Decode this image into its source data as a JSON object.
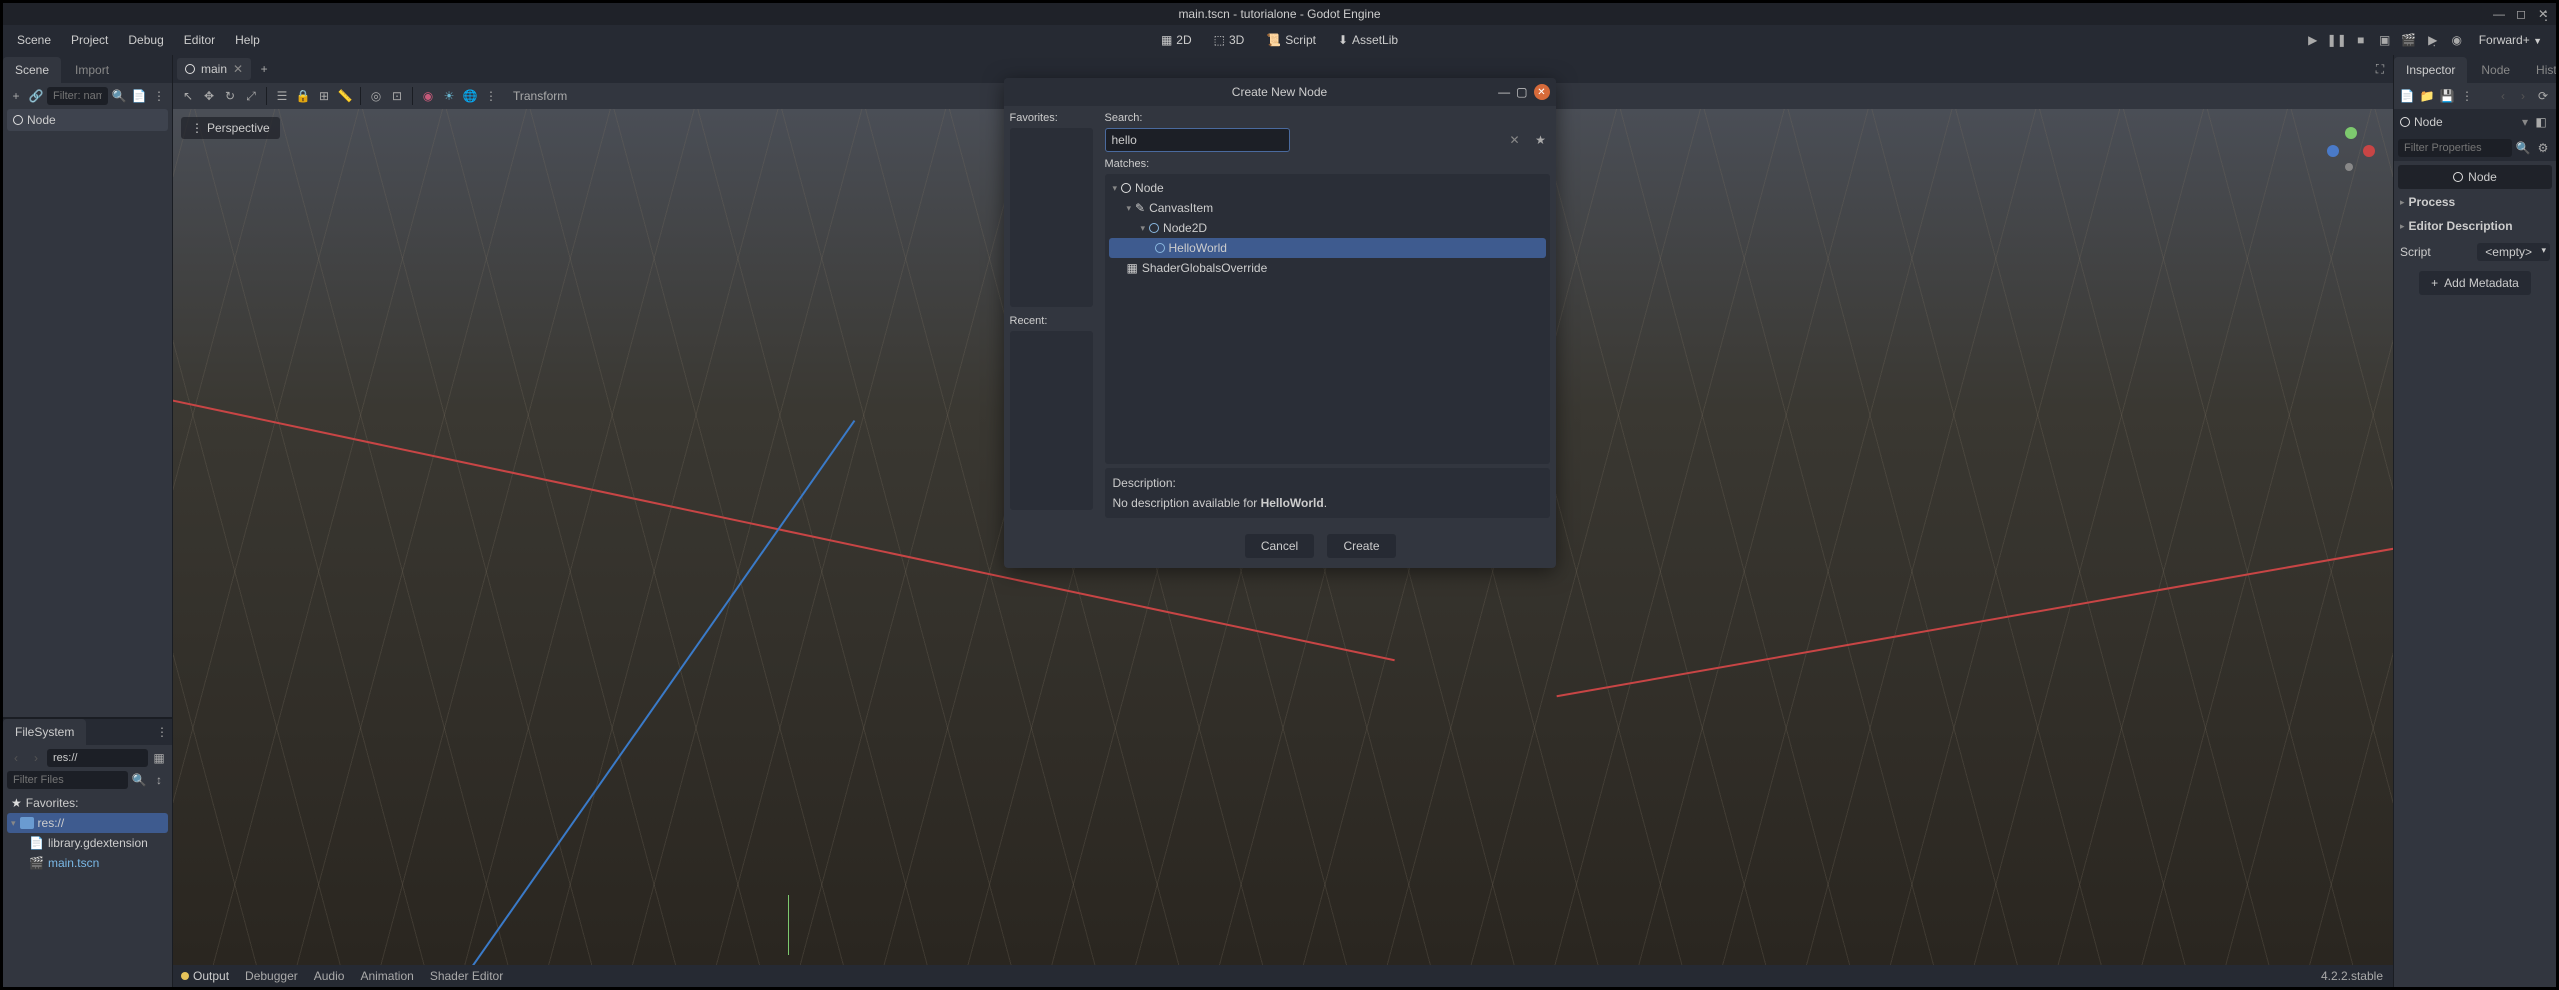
{
  "title": "main.tscn - tutorialone - Godot Engine",
  "menus": [
    "Scene",
    "Project",
    "Debug",
    "Editor",
    "Help"
  ],
  "modes": {
    "m2d": "2D",
    "m3d": "3D",
    "script": "Script",
    "assetlib": "AssetLib"
  },
  "renderer": "Forward+",
  "scene_dock": {
    "tab_scene": "Scene",
    "tab_import": "Import",
    "filter_ph": "Filter: name, t:type",
    "root": "Node"
  },
  "fs": {
    "title": "FileSystem",
    "path": "res://",
    "filter_ph": "Filter Files",
    "fav": "Favorites:",
    "root": "res://",
    "files": [
      "library.gdextension",
      "main.tscn"
    ]
  },
  "tab": {
    "name": "main"
  },
  "viewport": {
    "persp": "Perspective",
    "transform": "Transform"
  },
  "bottom": {
    "output": "Output",
    "debugger": "Debugger",
    "audio": "Audio",
    "animation": "Animation",
    "shader": "Shader Editor",
    "version": "4.2.2.stable"
  },
  "inspector": {
    "tab_insp": "Inspector",
    "tab_node": "Node",
    "tab_hist": "History",
    "node": "Node",
    "filter_ph": "Filter Properties",
    "badge": "Node",
    "process": "Process",
    "editor_desc": "Editor Description",
    "script": "Script",
    "empty": "<empty>",
    "add_meta": "Add Metadata"
  },
  "dialog": {
    "title": "Create New Node",
    "favorites": "Favorites:",
    "recent": "Recent:",
    "search_label": "Search:",
    "search_value": "hello",
    "matches": "Matches:",
    "tree": {
      "node": "Node",
      "canvas": "CanvasItem",
      "node2d": "Node2D",
      "hello": "HelloWorld",
      "shader": "ShaderGlobalsOverride"
    },
    "desc_label": "Description:",
    "desc_pre": "No description available for ",
    "desc_node": "HelloWorld",
    "desc_post": ".",
    "cancel": "Cancel",
    "create": "Create"
  }
}
